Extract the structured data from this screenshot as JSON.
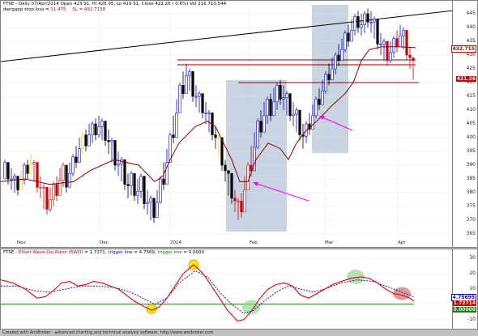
{
  "main": {
    "header_line1": "FTSE - Daily 07/Apr/2014 Open 423.91, Hi 426.95, Lo 419.91, Close 421.26 ( 0.6%) Vol 216,710,544",
    "header_line2_label": "dangapp stop loss = ",
    "header_line2_value": " 11.475",
    "header_sl_label": "SL",
    "header_sl_value": "= 432.7158",
    "yticks": [
      "445",
      "440",
      "435",
      "430",
      "425",
      "420",
      "415",
      "410",
      "405",
      "400",
      "395",
      "390",
      "385",
      "380",
      "375",
      "370",
      "365"
    ],
    "tag_sl": "432.715",
    "tag_close": "421.26",
    "dates": [
      "Nov",
      "Dec",
      "2014",
      "Feb",
      "Mar",
      "Apr"
    ]
  },
  "osc": {
    "name": "FTSE - ",
    "title": "Elliott Wave Oscillator (EWO)",
    "ewo_value": " = 1.7271,",
    "trigger_label": " trigger line",
    "trigger_value": " = 4.7569,",
    "trigger_label2": " trigger line",
    "trigger_value2": " = 0.0000",
    "yticks": [
      "30",
      "20",
      "10",
      "0",
      "-10"
    ],
    "tag_trigger": "4.75695",
    "tag_ewo": "1.72714",
    "tag_zero": "0.00000"
  },
  "credit": "Created with AmiBroker - advanced charting and technical analysis software. http://www.amibroker.com",
  "colors": {
    "bull": "#0000ff",
    "bear": "#000000",
    "red_bars": "#cc0000",
    "yellow_bars": "#e0d000",
    "trail": "#8b0000",
    "shade": "#9bb0c8",
    "arrow": "#ff00ff",
    "ewo": "#e00000",
    "trigger": "#0000cc",
    "zero": "#008000"
  }
}
